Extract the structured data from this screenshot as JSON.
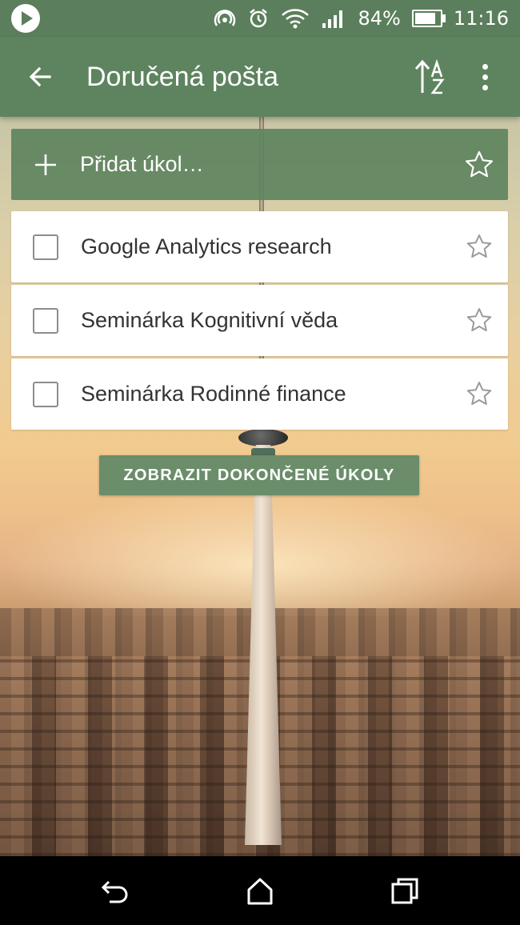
{
  "status_bar": {
    "battery_percent_text": "84%",
    "battery_level": 0.84,
    "time": "11:16",
    "icons": [
      "play-icon",
      "hotspot-icon",
      "alarm-icon",
      "wifi-icon",
      "signal-icon",
      "battery-icon"
    ]
  },
  "app_bar": {
    "title": "Doručená pošta",
    "icons": [
      "back-arrow-icon",
      "sort-az-icon",
      "more-vert-icon"
    ]
  },
  "add_task": {
    "placeholder": "Přidat úkol…",
    "icons": [
      "plus-icon",
      "star-outline-icon"
    ]
  },
  "tasks": [
    {
      "label": "Google Analytics research",
      "checked": false,
      "starred": false
    },
    {
      "label": "Seminárka Kognitivní věda",
      "checked": false,
      "starred": false
    },
    {
      "label": "Seminárka Rodinné finance",
      "checked": false,
      "starred": false
    }
  ],
  "show_completed_button": "ZOBRAZIT DOKONČENÉ ÚKOLY",
  "colors": {
    "primary": "#5e845f",
    "status_bar": "#5b7f5c",
    "button": "#6b8d6a",
    "task_bg": "#ffffff",
    "task_text": "#333333"
  },
  "navigation_bar": {
    "icons": [
      "back-nav-icon",
      "home-nav-icon",
      "recents-nav-icon"
    ]
  }
}
